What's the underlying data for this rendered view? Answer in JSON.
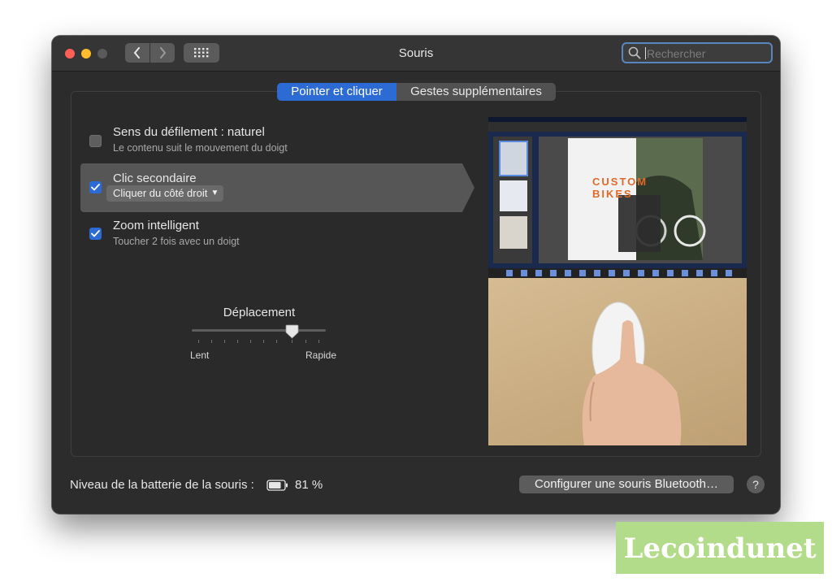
{
  "window": {
    "title": "Souris",
    "search": {
      "placeholder": "Rechercher"
    }
  },
  "tabs": [
    {
      "label": "Pointer et cliquer",
      "active": true
    },
    {
      "label": "Gestes supplémentaires",
      "active": false
    }
  ],
  "options": {
    "scroll": {
      "title": "Sens du défilement : naturel",
      "subtitle": "Le contenu suit le mouvement du doigt",
      "checked": false
    },
    "secondary": {
      "title": "Clic secondaire",
      "popup_value": "Cliquer du côté droit",
      "checked": true
    },
    "zoom": {
      "title": "Zoom intelligent",
      "subtitle": "Toucher 2 fois avec un doigt",
      "checked": true
    }
  },
  "tracking": {
    "label": "Déplacement",
    "min_label": "Lent",
    "max_label": "Rapide",
    "value_fraction": 0.75
  },
  "preview": {
    "overlay_text": "CUSTOM BIKES"
  },
  "footer": {
    "battery_label": "Niveau de la batterie de la souris :",
    "battery_percent": "81 %",
    "bluetooth_button": "Configurer une souris Bluetooth…",
    "help_label": "?"
  },
  "watermark": {
    "text": "Lecoindunet"
  },
  "colors": {
    "accent": "#2c6bd4",
    "window_bg": "#2c2c2c",
    "close": "#fe5f57",
    "minimize": "#febc2e"
  }
}
